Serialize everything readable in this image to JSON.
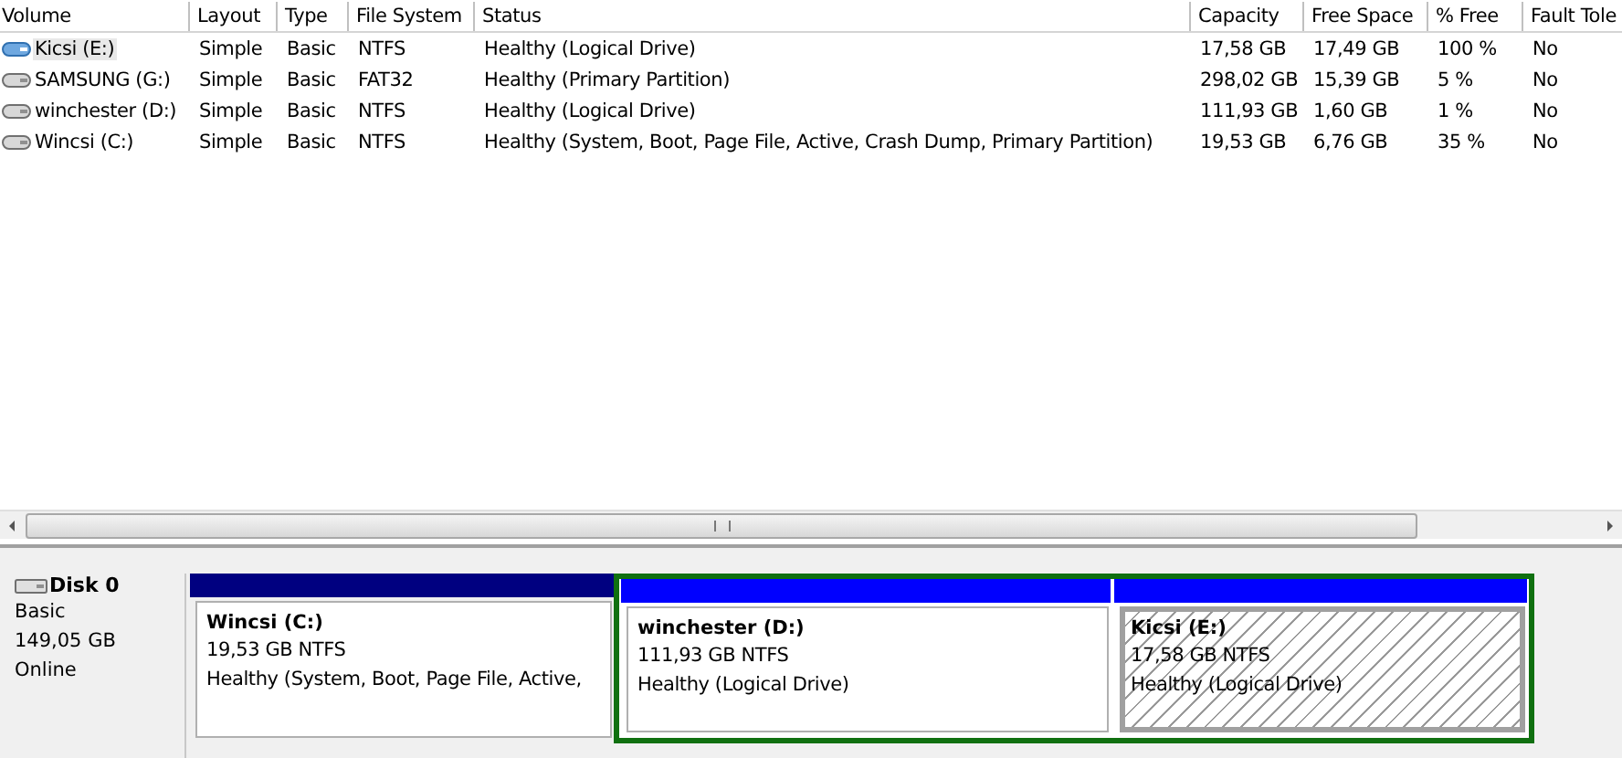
{
  "table": {
    "columns": [
      "Volume",
      "Layout",
      "Type",
      "File System",
      "Status",
      "Capacity",
      "Free Space",
      "% Free",
      "Fault Tole"
    ],
    "rows": [
      {
        "selected": true,
        "cells": [
          "Kicsi (E:)",
          "Simple",
          "Basic",
          "NTFS",
          "Healthy (Logical Drive)",
          "17,58 GB",
          "17,49 GB",
          "100 %",
          "No"
        ]
      },
      {
        "selected": false,
        "cells": [
          "SAMSUNG (G:)",
          "Simple",
          "Basic",
          "FAT32",
          "Healthy (Primary Partition)",
          "298,02 GB",
          "15,39 GB",
          "5 %",
          "No"
        ]
      },
      {
        "selected": false,
        "cells": [
          "winchester (D:)",
          "Simple",
          "Basic",
          "NTFS",
          "Healthy (Logical Drive)",
          "111,93 GB",
          "1,60 GB",
          "1 %",
          "No"
        ]
      },
      {
        "selected": false,
        "cells": [
          "Wincsi (C:)",
          "Simple",
          "Basic",
          "NTFS",
          "Healthy (System, Boot, Page File, Active, Crash Dump, Primary Partition)",
          "19,53 GB",
          "6,76 GB",
          "35 %",
          "No"
        ]
      }
    ]
  },
  "disk": {
    "name": "Disk 0",
    "type": "Basic",
    "size": "149,05 GB",
    "state": "Online",
    "partitions": [
      {
        "kind": "primary",
        "title": "Wincsi  (C:)",
        "size": "19,53 GB NTFS",
        "status": "Healthy (System, Boot, Page File, Active,",
        "selected": false
      },
      {
        "kind": "extended",
        "children": [
          {
            "kind": "logical",
            "title": "winchester  (D:)",
            "size": "111,93 GB NTFS",
            "status": "Healthy (Logical Drive)",
            "selected": false
          },
          {
            "kind": "logical",
            "title": "Kicsi  (E:)",
            "size": "17,58 GB NTFS",
            "status": "Healthy (Logical Drive)",
            "selected": true
          }
        ]
      }
    ]
  }
}
